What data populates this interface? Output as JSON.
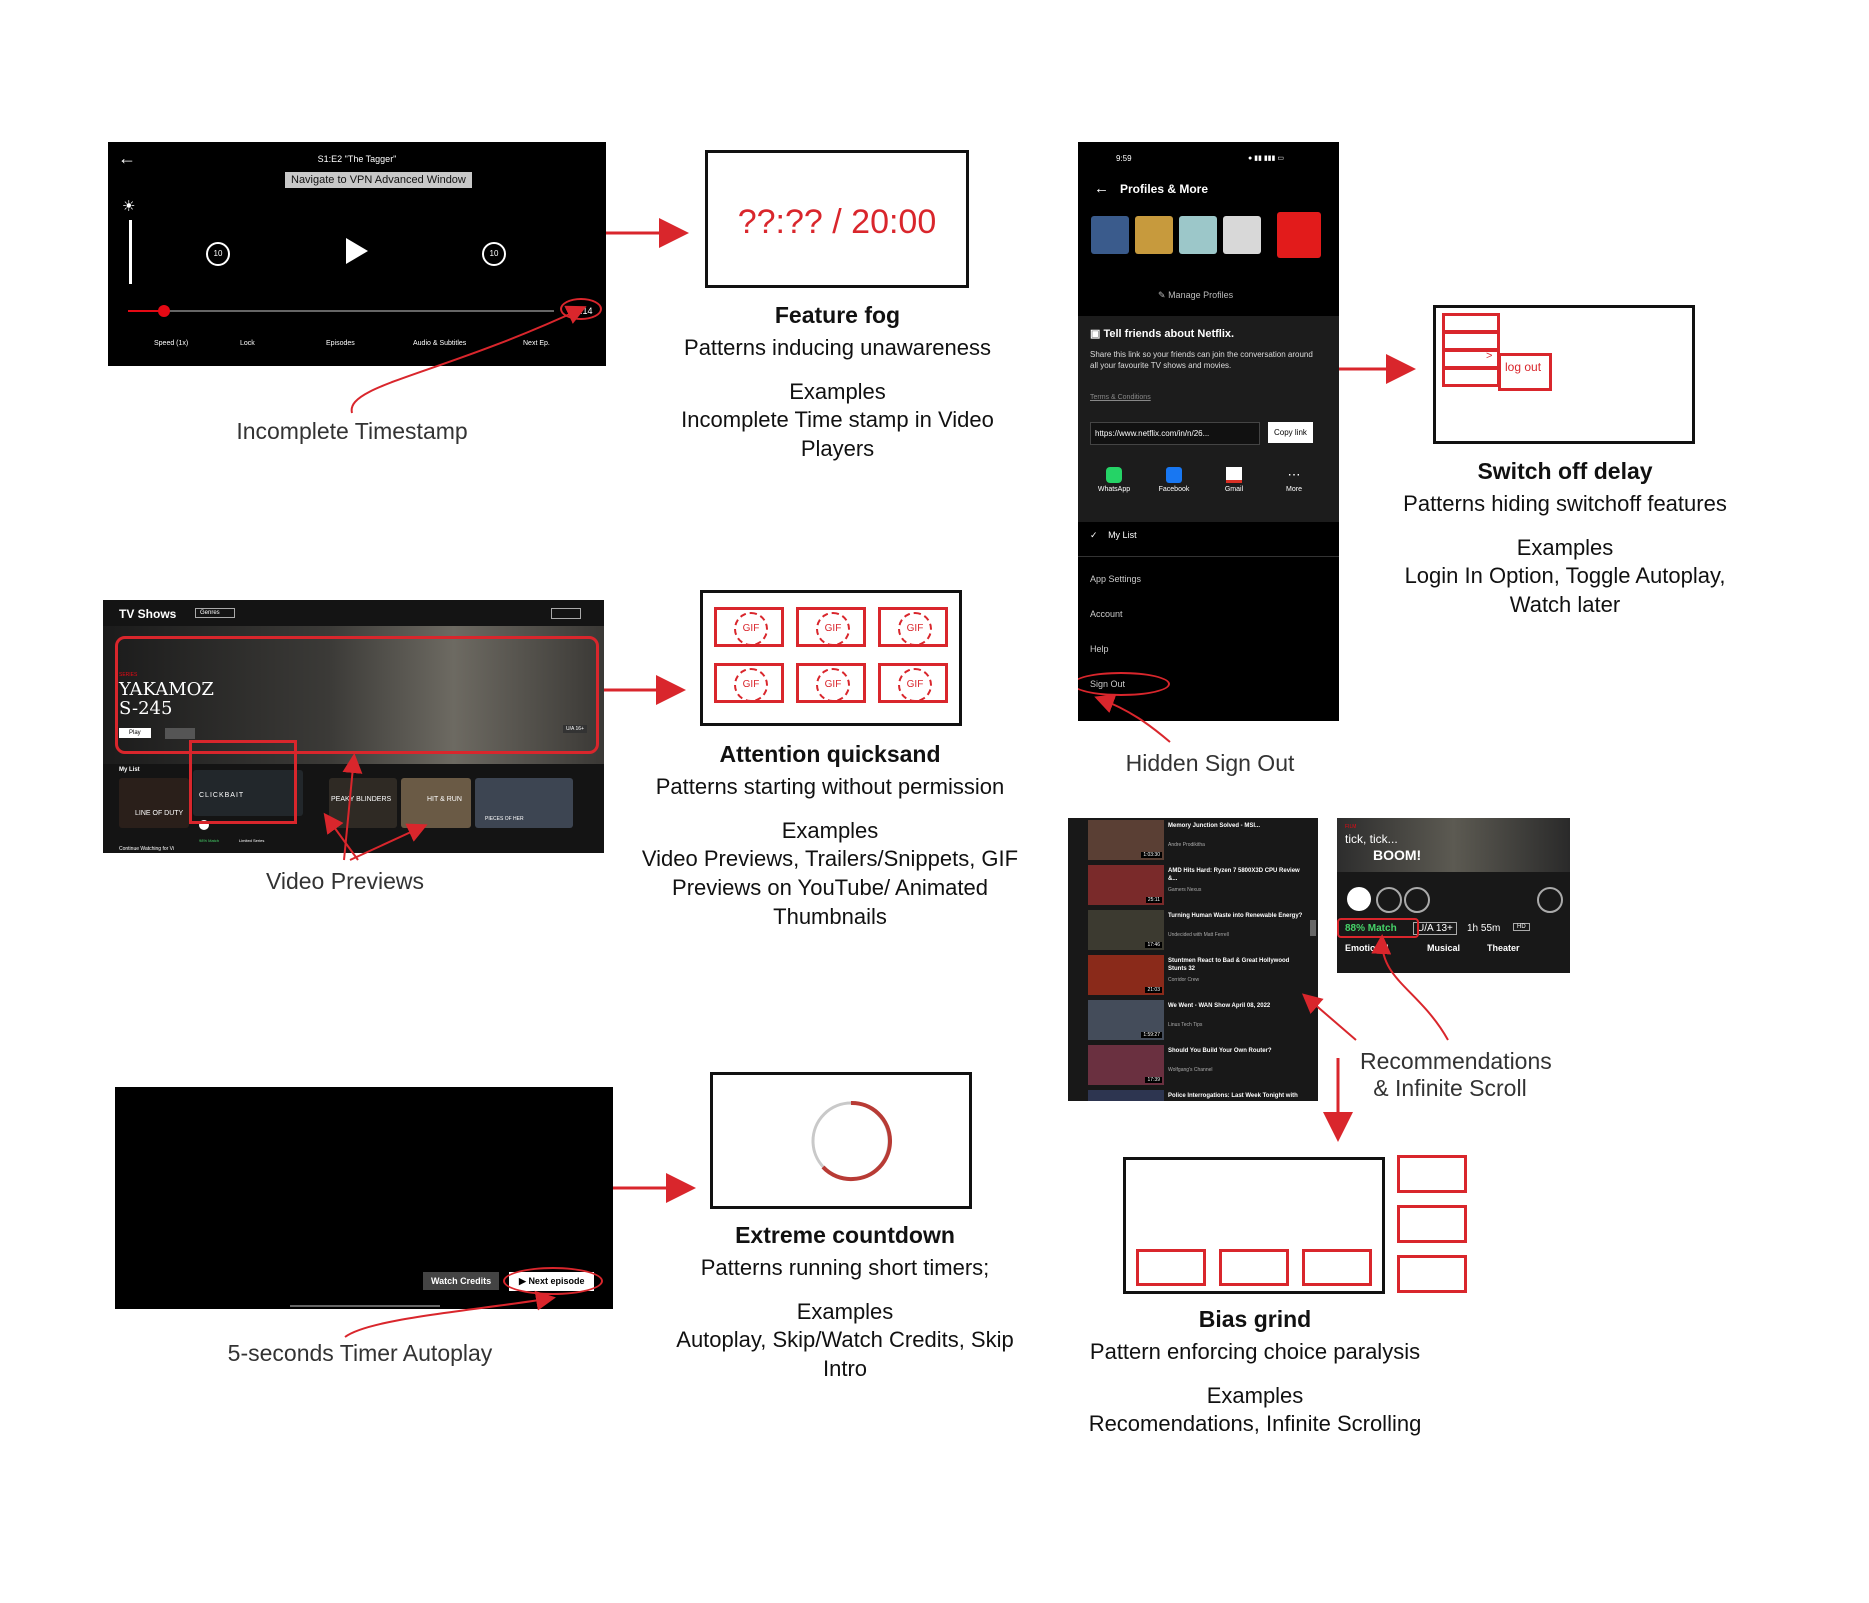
{
  "colors": {
    "accent": "#d9262c",
    "dark": "#000000",
    "match_green": "#46d369"
  },
  "player": {
    "episode_title": "S1:E2 \"The Tagger\"",
    "vpn_tooltip": "Navigate to VPN Advanced Window",
    "time": "19:14",
    "controls": [
      "Speed (1x)",
      "Lock",
      "Episodes",
      "Audio & Subtitles",
      "Next Ep."
    ],
    "caption": "Incomplete Timestamp"
  },
  "feature_fog": {
    "timestamp": "??:?? / 20:00",
    "title": "Feature fog",
    "subtitle": "Patterns inducing unawareness",
    "examples_label": "Examples",
    "examples": "Incomplete Time stamp in Video Players"
  },
  "tv_shows": {
    "header": "TV Shows",
    "genres": "Genres",
    "hero_tag": "SERIES",
    "hero_title": "YAKAMOZ S-245",
    "play": "Play",
    "rating": "U/A 16+",
    "my_list": "My List",
    "thumbs": [
      "LINE OF DUTY",
      "CLICKBAIT",
      "PEAKY BLINDERS",
      "HIT & RUN",
      "PIECES OF HER"
    ],
    "match": "98% Match",
    "limited": "Limited Series",
    "continue": "Continue Watching for Vi",
    "caption": "Video Previews"
  },
  "attention": {
    "gif_label": "GIF",
    "title": "Attention quicksand",
    "subtitle": "Patterns starting without permission",
    "examples_label": "Examples",
    "examples": "Video Previews,  Trailers/Snippets, GIF Previews on YouTube/ Animated Thumbnails"
  },
  "autoplay": {
    "watch_credits": "Watch Credits",
    "next_episode": "Next episode",
    "caption": "5-seconds Timer Autoplay"
  },
  "countdown": {
    "title": "Extreme countdown",
    "subtitle": "Patterns running short timers;",
    "examples_label": "Examples",
    "examples": "Autoplay, Skip/Watch Credits, Skip Intro"
  },
  "phone": {
    "time": "9:59",
    "header": "Profiles & More",
    "manage": "Manage Profiles",
    "tell_title": "Tell friends about Netflix.",
    "tell_body": "Share this link so your friends can join the conversation around all your favourite TV shows and movies.",
    "terms": "Terms & Conditions",
    "link": "https://www.netflix.com/in/n/26...",
    "copy": "Copy link",
    "share": [
      "WhatsApp",
      "Facebook",
      "Gmail",
      "More"
    ],
    "my_list": "My List",
    "menu": [
      "App Settings",
      "Account",
      "Help",
      "Sign Out"
    ],
    "caption": "Hidden Sign Out"
  },
  "switch_off": {
    "logout": "log out",
    "chevron": ">",
    "title": "Switch off delay",
    "subtitle": "Patterns hiding switchoff features",
    "examples_label": "Examples",
    "examples": "Login In Option, Toggle Autoplay, Watch later"
  },
  "youtube": {
    "items": [
      {
        "title": "Memory Junction Solved - MSI...",
        "meta": "Andre Prodikitha",
        "dur": "1:03:30"
      },
      {
        "title": "AMD Hits Hard: Ryzen 7 5800X3D CPU Review &...",
        "meta": "Gamers Nexus",
        "dur": "25:11"
      },
      {
        "title": "Turning Human Waste into Renewable Energy?",
        "meta": "Undecided with Matt Ferrell",
        "dur": "17:46"
      },
      {
        "title": "Stuntmen React to Bad & Great Hollywood Stunts 32",
        "meta": "Corridor Crew",
        "dur": "21:03"
      },
      {
        "title": "We Went - WAN Show April 08, 2022",
        "meta": "Linus Tech Tips",
        "dur": "1:59:27"
      },
      {
        "title": "Should You Build Your Own Router?",
        "meta": "Wolfgang's Channel",
        "dur": "17:39"
      },
      {
        "title": "Police Interrogations: Last Week Tonight with John Oliver",
        "meta": "",
        "dur": ""
      }
    ]
  },
  "netflix_card": {
    "film": "FILM",
    "title_a": "tick, tick...",
    "title_b": "BOOM!",
    "match": "88% Match",
    "rating": "U/A 13+",
    "duration": "1h 55m",
    "quality": "HD",
    "tags": [
      "Emotional",
      "Musical",
      "Theater"
    ]
  },
  "recommendations_caption": "Recommendations & Infinite Scroll",
  "bias": {
    "title": "Bias grind",
    "subtitle": "Pattern enforcing choice paralysis",
    "examples_label": "Examples",
    "examples": "Recomendations, Infinite Scrolling"
  }
}
